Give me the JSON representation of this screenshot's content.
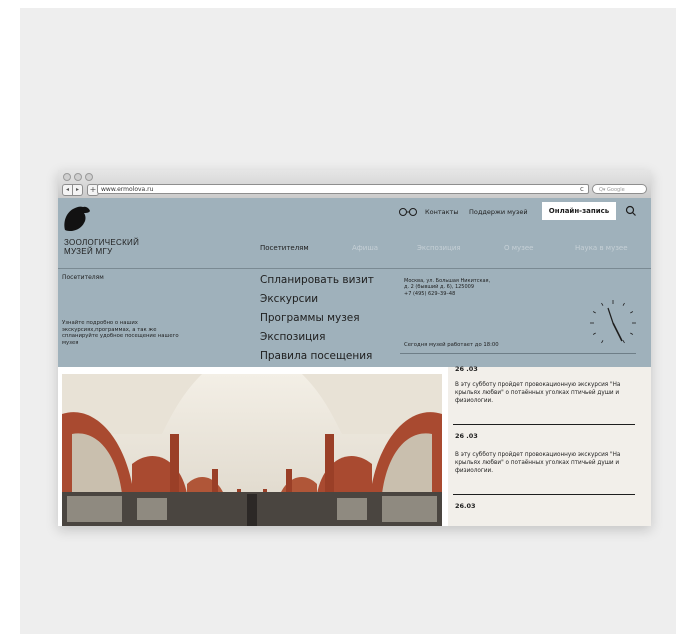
{
  "browser": {
    "url": "www.ermolova.ru",
    "search_placeholder": "Q▾ Google",
    "reload_glyph": "c",
    "back_glyph": "◂",
    "forward_glyph": "▸",
    "plus_glyph": "+"
  },
  "logo": {
    "line1": "ЗООЛОГИЧЕСКИЙ",
    "line2": "МУЗЕЙ МГУ",
    "icon": "beaver-logo-icon"
  },
  "utility_nav": {
    "contacts": "Контакты",
    "support": "Поддержи музей",
    "online_booking": "Онлайн-запись",
    "glasses_icon": "glasses-icon",
    "search_icon": "search-icon"
  },
  "main_nav": [
    {
      "label": "Посетителям",
      "active": true
    },
    {
      "label": "Афиша",
      "active": false
    },
    {
      "label": "Экспозиция",
      "active": false
    },
    {
      "label": "О музее",
      "active": false
    },
    {
      "label": "Наука в музее",
      "active": false
    }
  ],
  "dropdown": {
    "section_title": "Посетителям",
    "description": "Узнайте подробно о наших экскурсиях,программах, а так же спланируйте удобное посещение нашего музея",
    "menu": [
      "Спланировать визит",
      "Экскурсии",
      "Программы музея",
      "Экспозиция",
      "Правила посещения"
    ],
    "address_line1": "Москва, ул. Большая Никитская,",
    "address_line2": "д. 2 (бывший д. 6), 125009",
    "phone": "+7 (495) 629–39–48",
    "hours": "Сегодня музей работает до 18:00"
  },
  "news": [
    {
      "date": "26 .03",
      "text": "В эту субботу пройдет провокационную экскурсия \"На крыльях любви\" о потаённых уголках птичьей души и физиологии."
    },
    {
      "date": "26 .03",
      "text": "В эту субботу пройдет провокационную экскурсия \"На крыльях любви\" о потаённых уголках птичьей души и физиологии."
    },
    {
      "date": "26.03",
      "text": ""
    }
  ],
  "colors": {
    "header_bg": "#9fb1bb",
    "news_bg": "#f2efea",
    "text": "#1e1e1e",
    "nav_inactive": "#c6d0d6"
  }
}
